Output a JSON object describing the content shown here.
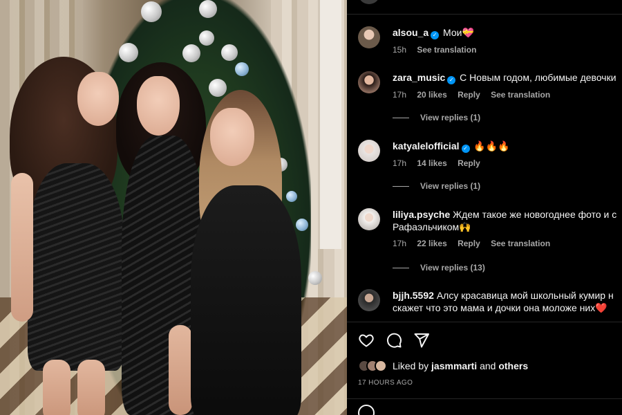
{
  "post": {
    "image_alt": "Three women in black dresses in front of a Christmas tree"
  },
  "comments": [
    {
      "username": "alsou_a",
      "verified": true,
      "text": "Мои💝",
      "time": "15h",
      "likes": "",
      "reply": "",
      "translate": "See translation",
      "avatar_color": "#6b5a4a"
    },
    {
      "username": "zara_music",
      "verified": true,
      "text": "С Новым годом, любимые девочки",
      "time": "17h",
      "likes": "20 likes",
      "reply": "Reply",
      "translate": "See translation",
      "replies": "View replies (1)",
      "avatar_color": "#8a6a5c"
    },
    {
      "username": "katyalelofficial",
      "verified": true,
      "text": "🔥🔥🔥",
      "time": "17h",
      "likes": "14 likes",
      "reply": "Reply",
      "translate": "",
      "replies": "View replies (1)",
      "avatar_color": "#d9d2cf"
    },
    {
      "username": "liliya.psyche",
      "verified": false,
      "text": "Ждем такое же новогоднее фото и с",
      "text_line2": "Рафаэльчиком🙌",
      "time": "17h",
      "likes": "22 likes",
      "reply": "Reply",
      "translate": "See translation",
      "replies": "View replies (13)",
      "avatar_color": "#c9c4c0"
    },
    {
      "username": "bjjh.5592",
      "verified": false,
      "text": "Алсу красавица мой школьный кумир н",
      "text_line2": "скажет что это мама и дочки она моложе них❤️",
      "avatar_color": "#4a4a4a"
    }
  ],
  "actions": {
    "like_icon": "heart-icon",
    "comment_icon": "comment-icon",
    "share_icon": "share-icon"
  },
  "likes": {
    "prefix": "Liked by",
    "user": "jasmmarti",
    "connector": "and",
    "others": "others",
    "avatar_colors": [
      "#5a4a42",
      "#a08070",
      "#d8b8a0"
    ]
  },
  "timestamp": "17 hours ago",
  "colors": {
    "background": "#000000",
    "text": "#f5f5f5",
    "muted": "#a8a8a8",
    "verified": "#0095f6",
    "divider": "#262626"
  }
}
